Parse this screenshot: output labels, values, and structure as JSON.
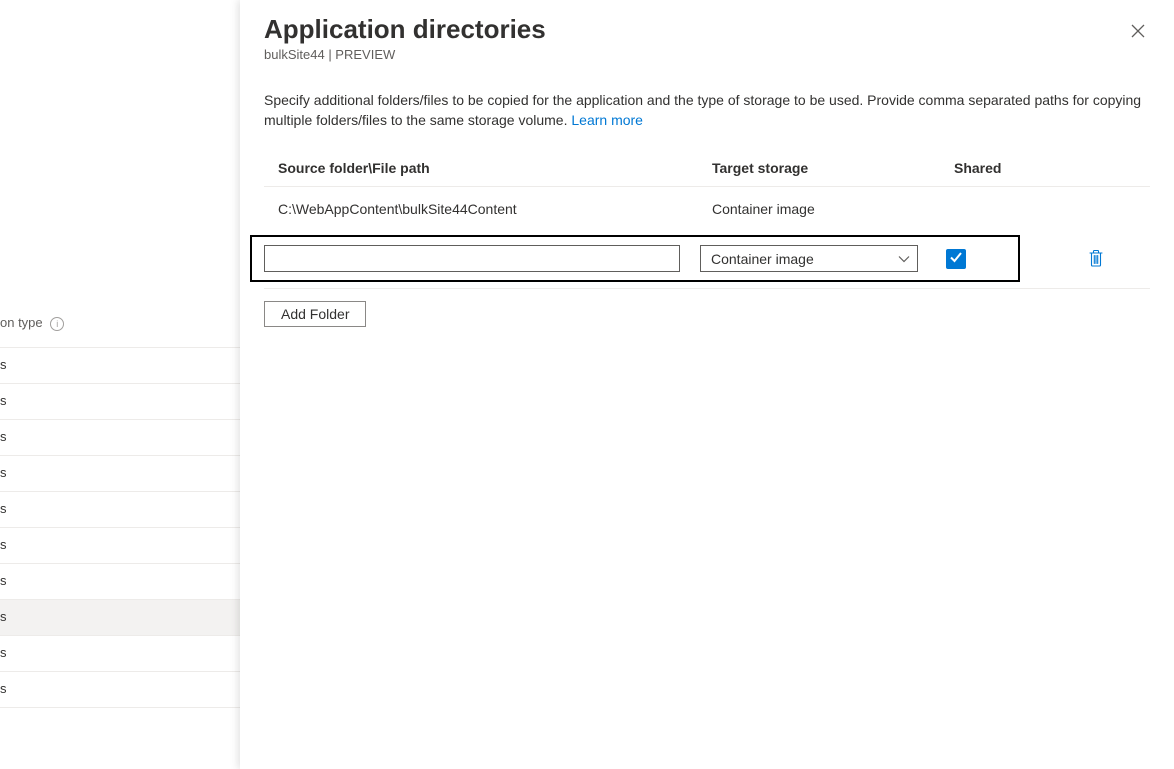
{
  "bg": {
    "header_label": "on type",
    "rows": [
      "s",
      "s",
      "s",
      "s",
      "s",
      "s",
      "s",
      "s",
      "s",
      "s"
    ],
    "selected_index": 7
  },
  "blade": {
    "title": "Application directories",
    "subtitle": "bulkSite44 | PREVIEW",
    "description_part1": "Specify additional folders/files to be copied for the application and the type of storage to be used. Provide comma separated paths for copying multiple folders/files to the same storage volume. ",
    "learn_more": "Learn more",
    "columns": {
      "source": "Source folder\\File path",
      "target": "Target storage",
      "shared": "Shared"
    },
    "rows": [
      {
        "source": "C:\\WebAppContent\\bulkSite44Content",
        "target": "Container image"
      }
    ],
    "edit_row": {
      "source_value": "",
      "target_selected": "Container image",
      "shared_checked": true
    },
    "add_folder_label": "Add Folder"
  }
}
